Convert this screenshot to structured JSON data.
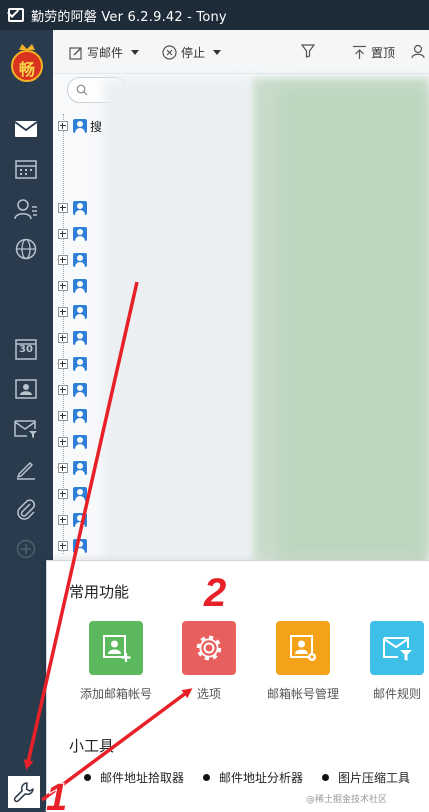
{
  "window": {
    "title": "勤劳的阿磐 Ver 6.2.9.42  -  Tony"
  },
  "sidebar": {
    "logo_char": "畅",
    "icons": [
      "mail-icon",
      "calendar-icon",
      "contacts-icon",
      "globe-icon",
      "date-30-icon",
      "address-card-icon",
      "mail-filter-icon",
      "pen-icon",
      "paperclip-icon",
      "add-circle-icon"
    ],
    "day_number": "30",
    "tools_icon": "wrench-icon"
  },
  "toolbar": {
    "compose_label": "写邮件",
    "stop_label": "停止",
    "pin_label": "置顶"
  },
  "folder_tree": {
    "search_label": "搜"
  },
  "popup": {
    "common_title": "常用功能",
    "tools_title": "小工具",
    "functions": [
      {
        "label": "添加邮箱帐号",
        "color": "#5cb85c"
      },
      {
        "label": "选项",
        "color": "#e8605e"
      },
      {
        "label": "邮箱帐号管理",
        "color": "#f5a21b"
      },
      {
        "label": "邮件规则",
        "color": "#3cc0e8"
      }
    ],
    "tools": [
      {
        "label": "邮件地址拾取器"
      },
      {
        "label": "邮件地址分析器"
      },
      {
        "label": "图片压缩工具"
      }
    ]
  },
  "annotations": {
    "step1": "1",
    "step2": "2",
    "arrow_color": "#e82128"
  },
  "watermark": "@稀土掘金技术社区"
}
